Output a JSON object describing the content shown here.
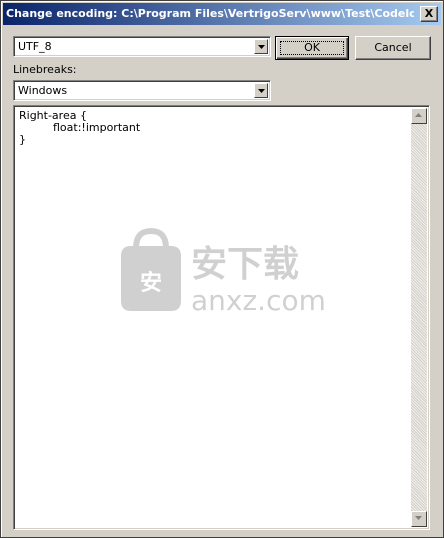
{
  "window": {
    "title": "Change encoding: C:\\Program Files\\VertrigoServ\\www\\Test\\Codelobste...",
    "close_label": "X"
  },
  "encoding": {
    "selected": "UTF_8"
  },
  "buttons": {
    "ok": "OK",
    "cancel": "Cancel"
  },
  "linebreaks": {
    "label": "Linebreaks:",
    "selected": "Windows"
  },
  "editor": {
    "lines": [
      "Right-area {",
      "float:!important",
      "}"
    ]
  },
  "icons": [
    "chevron-down-icon",
    "scroll-up-icon",
    "scroll-down-icon"
  ],
  "colors": {
    "title_bar_start": "#0a246a",
    "title_bar_end": "#a6caf0",
    "dialog_face": "#d4d0c8"
  },
  "watermark": {
    "logo_text": "安下载",
    "url_text": "anxz.com"
  }
}
